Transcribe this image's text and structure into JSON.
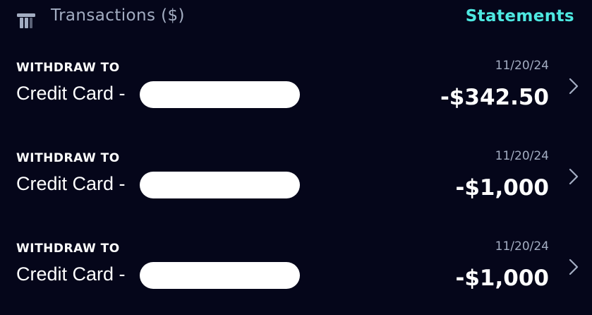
{
  "header": {
    "title": "Transactions ($)",
    "statements_label": "Statements",
    "icon": "bank-icon"
  },
  "colors": {
    "background": "#05061a",
    "accent": "#4ee8e1",
    "muted_text": "#a3adc2",
    "primary_text": "#ffffff"
  },
  "transactions": [
    {
      "type": "WITHDRAW TO",
      "destination": "Credit Card -",
      "date": "11/20/24",
      "amount": "-$342.50",
      "icon": "chevron-right-icon"
    },
    {
      "type": "WITHDRAW TO",
      "destination": "Credit Card -",
      "date": "11/20/24",
      "amount": "-$1,000",
      "icon": "chevron-right-icon"
    },
    {
      "type": "WITHDRAW TO",
      "destination": "Credit Card -",
      "date": "11/20/24",
      "amount": "-$1,000",
      "icon": "chevron-right-icon"
    }
  ]
}
